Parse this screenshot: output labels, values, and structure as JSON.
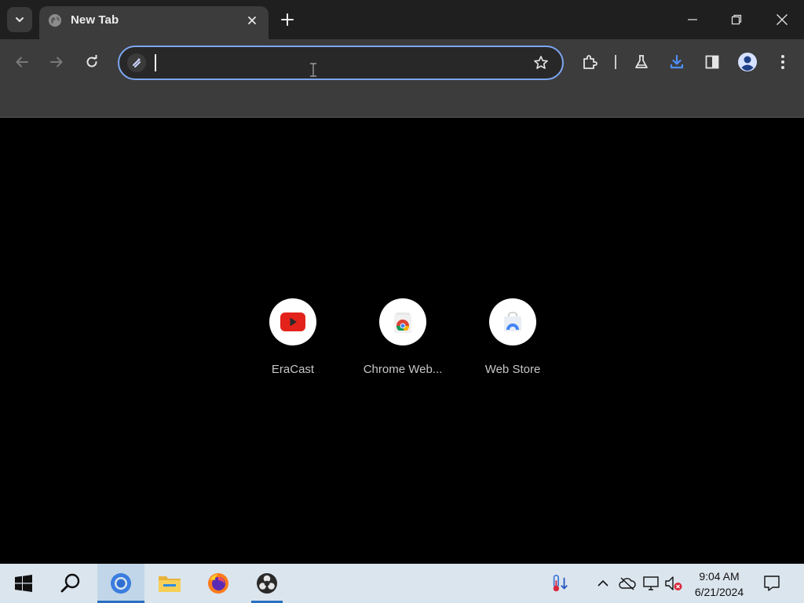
{
  "browser": {
    "tab": {
      "title": "New Tab",
      "favicon": "globe-icon"
    },
    "window_controls": [
      "minimize-icon",
      "restore-icon",
      "close-icon"
    ],
    "address_bar": {
      "value": "",
      "placeholder": ""
    },
    "toolbar_icons": [
      "back-icon",
      "forward-icon",
      "reload-icon",
      "extensions-icon",
      "labs-flask-icon",
      "download-icon",
      "side-panel-icon",
      "profile-avatar-icon",
      "menu-dots-icon"
    ],
    "accent_color": "#7ca7f2"
  },
  "shortcuts": [
    {
      "label": "EraCast",
      "icon": "youtube-icon"
    },
    {
      "label": "Chrome Web...",
      "icon": "chrome-web-store-icon"
    },
    {
      "label": "Web Store",
      "icon": "web-store-icon"
    }
  ],
  "taskbar": {
    "apps": [
      "windows-start-icon",
      "search-icon",
      "chrome-icon",
      "file-explorer-icon",
      "firefox-icon",
      "obs-icon"
    ],
    "tray": [
      "thermometer-icon",
      "chevron-up-icon",
      "cloud-offline-icon",
      "network-icon",
      "volume-muted-icon"
    ],
    "clock": {
      "time": "9:04 AM",
      "date": "6/21/2024"
    },
    "notification_icon": "notification-icon"
  }
}
